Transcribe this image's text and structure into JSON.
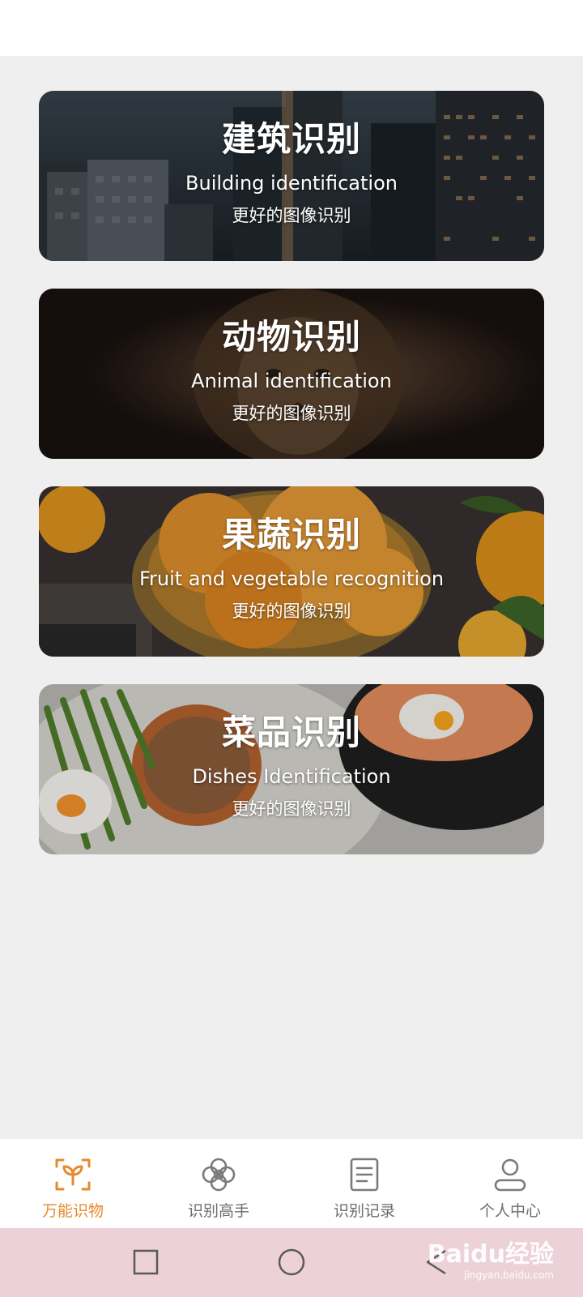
{
  "cards": [
    {
      "title": "建筑识别",
      "subtitle_en": "Building identification",
      "tagline": "更好的图像识别"
    },
    {
      "title": "动物识别",
      "subtitle_en": "Animal identification",
      "tagline": "更好的图像识别"
    },
    {
      "title": "果蔬识别",
      "subtitle_en": "Fruit and vegetable recognition",
      "tagline": "更好的图像识别"
    },
    {
      "title": "菜品识别",
      "subtitle_en": "Dishes Identification",
      "tagline": "更好的图像识别"
    }
  ],
  "tabbar": {
    "items": [
      {
        "label": "万能识物",
        "icon": "scan-sprout-icon",
        "active": true
      },
      {
        "label": "识别高手",
        "icon": "flower-icon",
        "active": false
      },
      {
        "label": "识别记录",
        "icon": "document-list-icon",
        "active": false
      },
      {
        "label": "个人中心",
        "icon": "person-icon",
        "active": false
      }
    ]
  },
  "system_nav": {
    "buttons": [
      "recent-apps-square-icon",
      "home-circle-icon",
      "back-triangle-icon"
    ]
  },
  "watermark": {
    "brand": "Baidu经验",
    "site": "jingyan.baidu.com"
  },
  "colors": {
    "accent": "#e58a2e",
    "tab_inactive": "#6d6d6d",
    "content_background": "#efefef",
    "system_nav_background": "#ecd2d8"
  }
}
